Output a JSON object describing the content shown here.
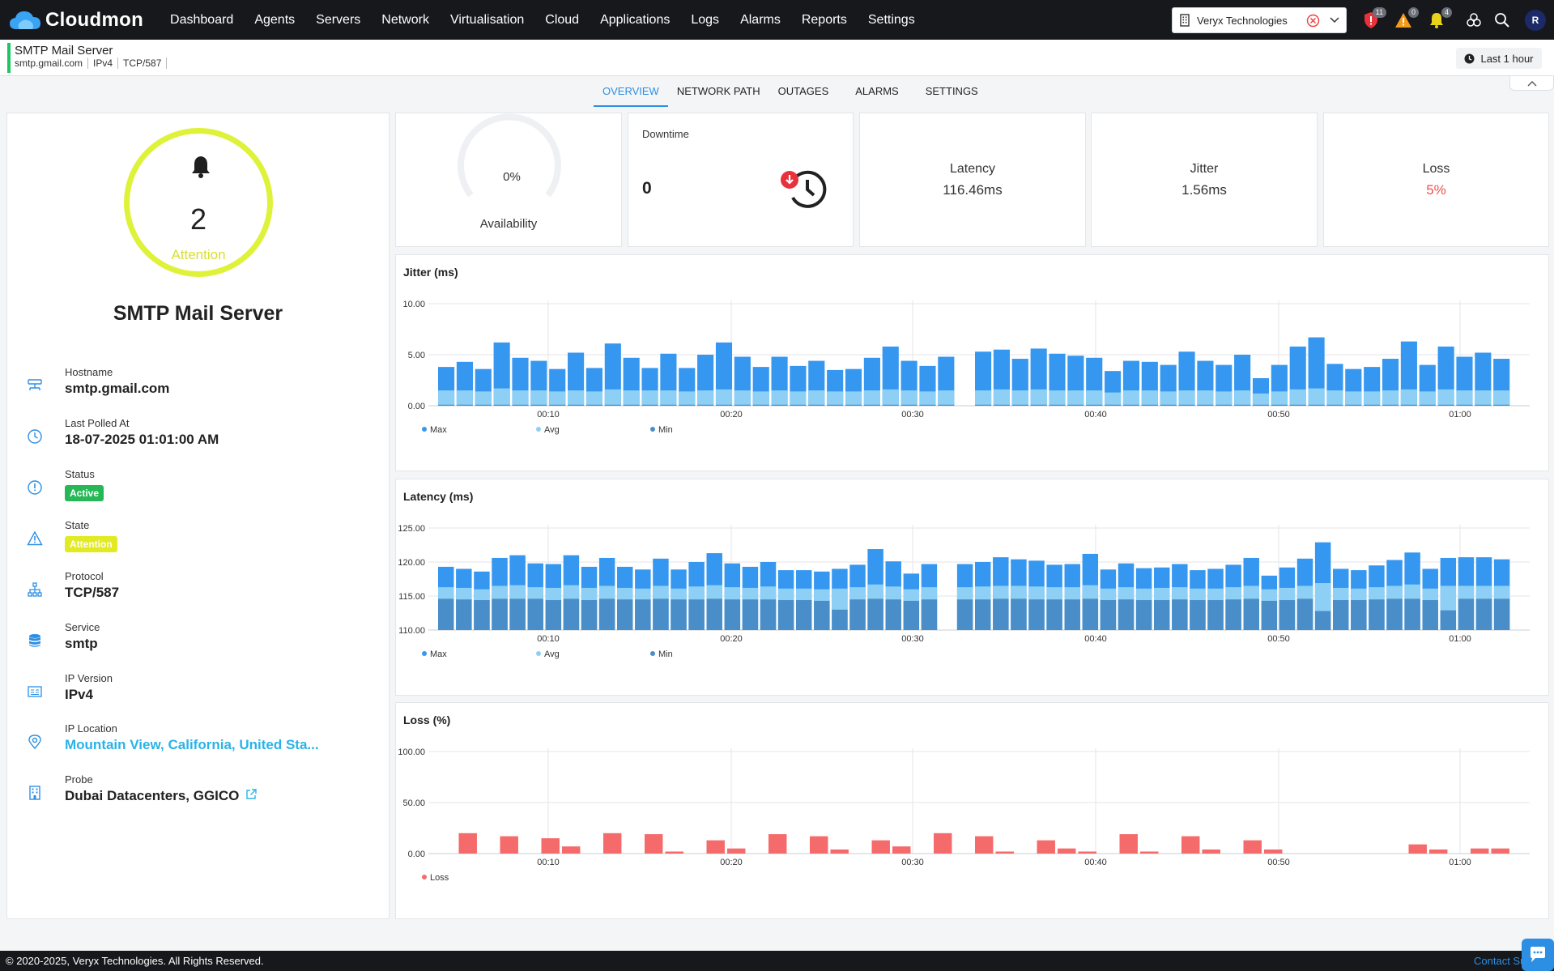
{
  "app": {
    "name": "Cloudmon"
  },
  "nav": {
    "items": [
      {
        "label": "Dashboard"
      },
      {
        "label": "Agents"
      },
      {
        "label": "Servers"
      },
      {
        "label": "Network"
      },
      {
        "label": "Virtualisation"
      },
      {
        "label": "Cloud"
      },
      {
        "label": "Applications"
      },
      {
        "label": "Logs"
      },
      {
        "label": "Alarms"
      },
      {
        "label": "Reports"
      },
      {
        "label": "Settings"
      }
    ],
    "org": "Veryx Technologies",
    "badges": {
      "security": "11",
      "warning": "0",
      "notifications": "4"
    },
    "avatar": "R",
    "icons": [
      "building-icon",
      "clear-circle-icon",
      "chevron-down-icon",
      "shield-alert-icon",
      "warning-icon",
      "bell-icon",
      "integrations-icon",
      "search-icon"
    ]
  },
  "header": {
    "title": "SMTP Mail Server",
    "meta": [
      "smtp.gmail.com",
      "IPv4",
      "TCP/587"
    ],
    "time_range": "Last 1 hour"
  },
  "tabs": [
    {
      "label": "OVERVIEW",
      "active": true
    },
    {
      "label": "NETWORK PATH"
    },
    {
      "label": "OUTAGES"
    },
    {
      "label": "ALARMS"
    },
    {
      "label": "SETTINGS"
    }
  ],
  "summary": {
    "alarm_count": "2",
    "state": "Attention",
    "ring_color": "#dff23a",
    "device_name": "SMTP Mail Server"
  },
  "properties": {
    "hostname": {
      "label": "Hostname",
      "value": "smtp.gmail.com"
    },
    "last_polled": {
      "label": "Last Polled At",
      "value": "18-07-2025 01:01:00 AM"
    },
    "status": {
      "label": "Status",
      "value": "Active"
    },
    "state": {
      "label": "State",
      "value": "Attention"
    },
    "protocol": {
      "label": "Protocol",
      "value": "TCP/587"
    },
    "service": {
      "label": "Service",
      "value": "smtp"
    },
    "ip_version": {
      "label": "IP Version",
      "value": "IPv4"
    },
    "ip_location": {
      "label": "IP Location",
      "value": "Mountain View, California, United Sta..."
    },
    "probe": {
      "label": "Probe",
      "value": "Dubai Datacenters, GGICO"
    }
  },
  "kpis": {
    "availability": {
      "value": "0%",
      "label": "Availability",
      "fraction": 0
    },
    "downtime": {
      "label": "Downtime",
      "value": "0"
    },
    "latency": {
      "label": "Latency",
      "value": "116.46ms"
    },
    "jitter": {
      "label": "Jitter",
      "value": "1.56ms"
    },
    "loss": {
      "label": "Loss",
      "value": "5%",
      "color": "#f04f4f"
    }
  },
  "chart_data": [
    {
      "type": "bar",
      "title": "Jitter (ms)",
      "ylim": [
        0,
        10
      ],
      "yticks": [
        "10.00",
        "5.00",
        "0.00"
      ],
      "xticks": [
        "00:10",
        "00:20",
        "00:30",
        "00:40",
        "00:50",
        "01:00"
      ],
      "legend": [
        "Max",
        "Avg",
        "Min"
      ],
      "colors": {
        "max": "#3597f0",
        "avg": "#8ed0f5",
        "min": "#4a8ec9"
      },
      "series": [
        {
          "name": "Max",
          "values": [
            3.8,
            4.3,
            3.6,
            6.2,
            4.7,
            4.4,
            3.6,
            5.2,
            3.7,
            6.1,
            4.7,
            3.7,
            5.1,
            3.7,
            5.0,
            6.2,
            4.8,
            3.8,
            4.8,
            3.9,
            4.4,
            3.5,
            3.6,
            4.7,
            5.8,
            4.4,
            3.9,
            4.8,
            null,
            5.3,
            5.5,
            4.6,
            5.6,
            5.1,
            4.9,
            4.7,
            3.4,
            4.4,
            4.3,
            4.0,
            5.3,
            4.4,
            4.0,
            5.0,
            2.7,
            4.0,
            5.8,
            6.7,
            4.1,
            3.6,
            3.8,
            4.6,
            6.3,
            4.0,
            5.8,
            4.8,
            5.2,
            4.6
          ]
        },
        {
          "name": "Avg",
          "values": [
            1.5,
            1.5,
            1.4,
            1.7,
            1.5,
            1.5,
            1.4,
            1.5,
            1.4,
            1.6,
            1.5,
            1.5,
            1.5,
            1.4,
            1.5,
            1.6,
            1.5,
            1.4,
            1.5,
            1.4,
            1.5,
            1.4,
            1.4,
            1.5,
            1.6,
            1.5,
            1.4,
            1.5,
            null,
            1.5,
            1.6,
            1.5,
            1.6,
            1.5,
            1.5,
            1.5,
            1.3,
            1.5,
            1.5,
            1.4,
            1.5,
            1.5,
            1.4,
            1.5,
            1.2,
            1.4,
            1.6,
            1.7,
            1.5,
            1.4,
            1.4,
            1.5,
            1.6,
            1.4,
            1.6,
            1.5,
            1.5,
            1.5
          ]
        },
        {
          "name": "Min",
          "values": [
            0.1,
            0.1,
            0.1,
            0.1,
            0.1,
            0.1,
            0.1,
            0.1,
            0.1,
            0.1,
            0.1,
            0.1,
            0.1,
            0.1,
            0.1,
            0.1,
            0.1,
            0.1,
            0.1,
            0.1,
            0.1,
            0.1,
            0.1,
            0.1,
            0.1,
            0.1,
            0.1,
            0.1,
            null,
            0.1,
            0.1,
            0.1,
            0.1,
            0.1,
            0.1,
            0.1,
            0.1,
            0.1,
            0.1,
            0.1,
            0.1,
            0.1,
            0.1,
            0.1,
            0.1,
            0.1,
            0.1,
            0.1,
            0.1,
            0.1,
            0.1,
            0.1,
            0.1,
            0.1,
            0.1,
            0.1,
            0.1,
            0.1
          ]
        }
      ]
    },
    {
      "type": "bar",
      "title": "Latency (ms)",
      "ylim": [
        110,
        125
      ],
      "yticks": [
        "125.00",
        "120.00",
        "115.00",
        "110.00"
      ],
      "xticks": [
        "00:10",
        "00:20",
        "00:30",
        "00:40",
        "00:50",
        "01:00"
      ],
      "legend": [
        "Max",
        "Avg",
        "Min"
      ],
      "colors": {
        "max": "#3597f0",
        "avg": "#8ed0f5",
        "min": "#4a8ec9"
      },
      "series": [
        {
          "name": "Max",
          "values": [
            119.3,
            119.0,
            118.6,
            120.6,
            121.0,
            119.8,
            119.7,
            121.0,
            119.3,
            120.6,
            119.3,
            118.9,
            120.5,
            118.9,
            120.0,
            121.3,
            119.8,
            119.3,
            120.0,
            118.8,
            118.8,
            118.6,
            119.0,
            119.6,
            121.9,
            120.1,
            118.3,
            119.7,
            null,
            119.7,
            120.0,
            120.7,
            120.4,
            120.2,
            119.6,
            119.7,
            121.2,
            118.9,
            119.8,
            119.1,
            119.2,
            119.7,
            118.8,
            119.0,
            119.6,
            120.6,
            118.0,
            119.2,
            120.5,
            122.9,
            119.0,
            118.8,
            119.5,
            120.3,
            121.4,
            119.0,
            120.6,
            120.7,
            120.7,
            120.4
          ]
        },
        {
          "name": "Avg",
          "values": [
            116.3,
            116.2,
            116.0,
            116.5,
            116.6,
            116.3,
            116.2,
            116.6,
            116.2,
            116.5,
            116.2,
            116.1,
            116.5,
            116.1,
            116.4,
            116.6,
            116.3,
            116.2,
            116.4,
            116.1,
            116.1,
            116.0,
            116.1,
            116.3,
            116.7,
            116.4,
            116.0,
            116.3,
            null,
            116.3,
            116.4,
            116.5,
            116.5,
            116.4,
            116.3,
            116.3,
            116.6,
            116.1,
            116.3,
            116.1,
            116.2,
            116.3,
            116.1,
            116.1,
            116.3,
            116.5,
            116.0,
            116.2,
            116.5,
            116.9,
            116.2,
            116.1,
            116.3,
            116.5,
            116.7,
            116.1,
            116.5,
            116.5,
            116.5,
            116.5
          ]
        },
        {
          "name": "Min",
          "values": [
            114.6,
            114.5,
            114.4,
            114.6,
            114.6,
            114.6,
            114.4,
            114.6,
            114.4,
            114.6,
            114.5,
            114.5,
            114.6,
            114.5,
            114.5,
            114.6,
            114.5,
            114.5,
            114.5,
            114.4,
            114.4,
            114.3,
            113.0,
            114.5,
            114.6,
            114.5,
            114.3,
            114.5,
            null,
            114.5,
            114.5,
            114.6,
            114.6,
            114.5,
            114.5,
            114.5,
            114.6,
            114.4,
            114.5,
            114.4,
            114.4,
            114.5,
            114.4,
            114.4,
            114.5,
            114.6,
            114.3,
            114.4,
            114.6,
            112.8,
            114.4,
            114.4,
            114.5,
            114.6,
            114.6,
            114.4,
            112.9,
            114.6,
            114.6,
            114.6
          ]
        }
      ]
    },
    {
      "type": "bar",
      "title": "Loss (%)",
      "ylim": [
        0,
        100
      ],
      "yticks": [
        "100.00",
        "50.00",
        "0.00"
      ],
      "xticks": [
        "00:10",
        "00:20",
        "00:30",
        "00:40",
        "00:50",
        "01:00"
      ],
      "legend": [
        "Loss"
      ],
      "colors": {
        "loss": "#f56a6a"
      },
      "series": [
        {
          "name": "Loss",
          "values": [
            0,
            20,
            0,
            17,
            0,
            15,
            7,
            0,
            20,
            0,
            19,
            2,
            0,
            13,
            5,
            0,
            19,
            0,
            17,
            4,
            0,
            13,
            7,
            0,
            20,
            0,
            17,
            2,
            0,
            13,
            5,
            2,
            0,
            19,
            2,
            0,
            17,
            4,
            0,
            13,
            4,
            0,
            0,
            0,
            0,
            0,
            0,
            9,
            4,
            0,
            5,
            5
          ]
        }
      ]
    }
  ]
}
